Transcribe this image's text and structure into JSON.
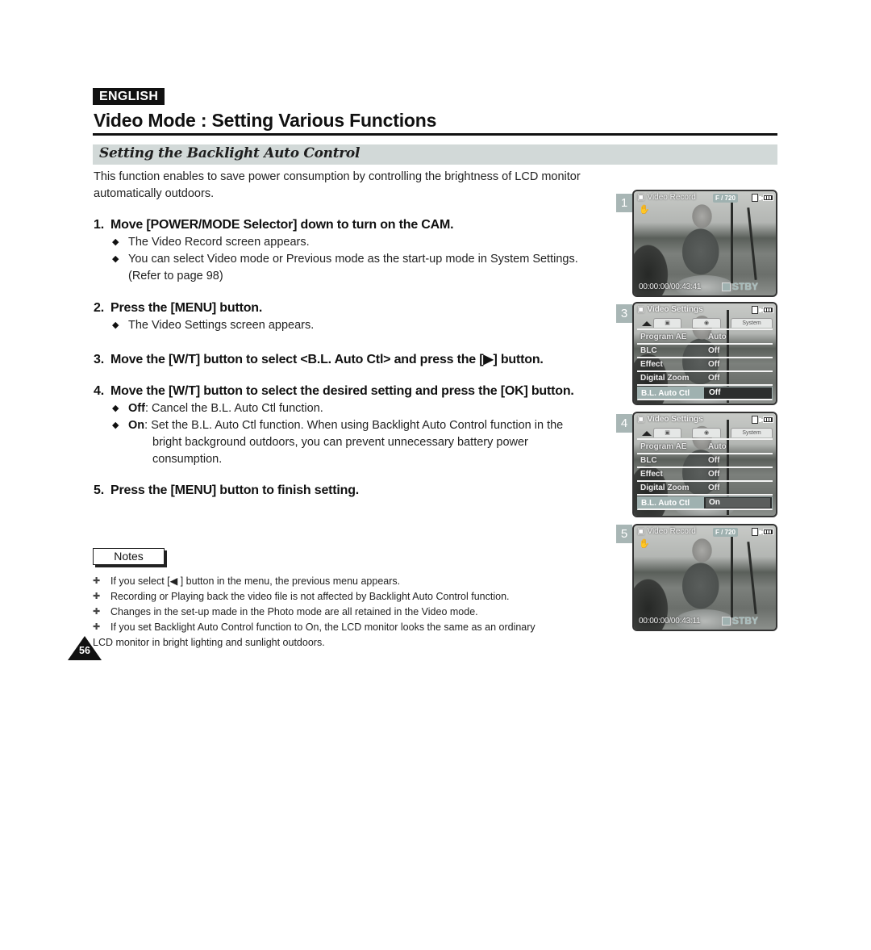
{
  "header": {
    "language_badge": "ENGLISH",
    "page_title": "Video Mode : Setting Various Functions",
    "section_title": "Setting the Backlight Auto Control"
  },
  "intro": "This function enables to save power consumption by controlling the brightness of LCD monitor automatically outdoors.",
  "steps": [
    {
      "number": "1.",
      "text": "Move [POWER/MODE Selector] down to turn on the CAM.",
      "bullets": [
        "The Video Record screen appears.",
        "You can select Video mode or Previous mode as the start-up mode in System Settings. (Refer to page 98)"
      ]
    },
    {
      "number": "2.",
      "text": "Press the [MENU] button.",
      "bullets": [
        "The Video Settings screen appears."
      ]
    },
    {
      "number": "3.",
      "text": "Move the [W/T] button to select <B.L. Auto Ctl> and press the [▶] button.",
      "bullets": []
    },
    {
      "number": "4.",
      "text": "Move the [W/T] button to select the desired setting and press the [OK] button.",
      "bullets": [
        {
          "term": "Off",
          "text": ": Cancel the B.L. Auto Ctl function."
        },
        {
          "term": "On",
          "text": ": Set the B.L. Auto Ctl function. When using Backlight Auto Control function in the",
          "cont": "bright background outdoors, you can prevent unnecessary battery power consumption."
        }
      ]
    },
    {
      "number": "5.",
      "text": "Press the [MENU] button to finish setting.",
      "bullets": []
    }
  ],
  "notes": {
    "label": "Notes",
    "items": [
      "If you select [◀ ] button in the menu, the previous menu appears.",
      "Recording or Playing back the video file is not affected by Backlight Auto Control function.",
      "Changes in the set-up made in the Photo mode are all retained in the Video mode.",
      "If you set Backlight Auto Control function to On, the LCD monitor looks the same as an ordinary"
    ],
    "last_item_continuation": "LCD monitor in bright lighting and sunlight outdoors."
  },
  "page_number": "56",
  "screens": [
    {
      "label": "1",
      "type": "record",
      "title": "Video Record",
      "resolution": "F / 720",
      "timecode": "00:00:00/00:43:41",
      "status": "STBY"
    },
    {
      "label": "3",
      "type": "settings",
      "title": "Video Settings",
      "tabs": [
        "▣",
        "◉",
        "System"
      ],
      "rows": [
        {
          "key": "Program AE",
          "value": "Auto"
        },
        {
          "key": "BLC",
          "value": "Off"
        },
        {
          "key": "Effect",
          "value": "Off"
        },
        {
          "key": "Digital Zoom",
          "value": "Off"
        },
        {
          "key": "B.L. Auto Ctl",
          "value": "Off"
        }
      ]
    },
    {
      "label": "4",
      "type": "settings",
      "title": "Video Settings",
      "tabs": [
        "▣",
        "◉",
        "System"
      ],
      "rows": [
        {
          "key": "Program AE",
          "value": "Auto"
        },
        {
          "key": "BLC",
          "value": "Off"
        },
        {
          "key": "Effect",
          "value": "Off"
        },
        {
          "key": "Digital Zoom",
          "value": "Off"
        },
        {
          "key": "B.L. Auto Ctl",
          "value": "On"
        }
      ]
    },
    {
      "label": "5",
      "type": "record",
      "title": "Video Record",
      "resolution": "F / 720",
      "timecode": "00:00:00/00:43:11",
      "status": "STBY"
    }
  ],
  "icons": {
    "bullet": "◆",
    "note_marker": "✚",
    "camcorder": "▣",
    "hand_stabilizer": "✋"
  }
}
